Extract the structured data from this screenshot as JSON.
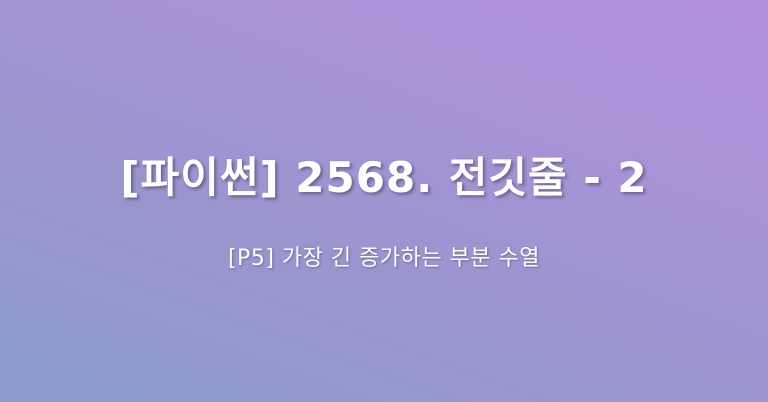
{
  "banner": {
    "title": "[파이썬] 2568. 전깃줄 - 2",
    "subtitle": "[P5] 가장 긴 증가하는 부분 수열"
  }
}
